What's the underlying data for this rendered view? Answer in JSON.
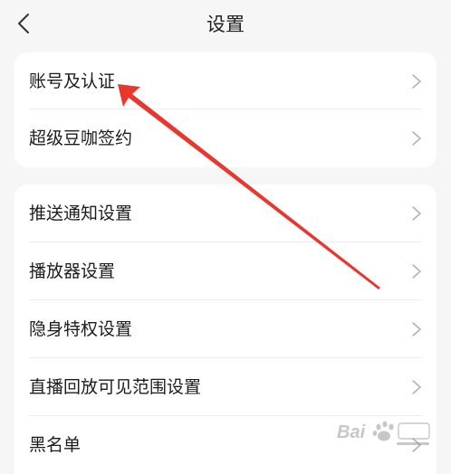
{
  "header": {
    "title": "设置"
  },
  "groups": [
    {
      "items": [
        {
          "label": "账号及认证"
        },
        {
          "label": "超级豆咖签约"
        }
      ]
    },
    {
      "items": [
        {
          "label": "推送通知设置"
        },
        {
          "label": "播放器设置"
        },
        {
          "label": "隐身特权设置"
        },
        {
          "label": "直播回放可见范围设置"
        },
        {
          "label": "黑名单"
        }
      ]
    }
  ],
  "annotation": {
    "arrow_color": "#e8372f"
  },
  "watermark": {
    "icon": "baidu-paw-logo"
  },
  "colors": {
    "background": "#f6f6f6",
    "card": "#ffffff",
    "text": "#1c1c1c",
    "chevron": "#b3b3b3",
    "divider": "#ececec"
  }
}
